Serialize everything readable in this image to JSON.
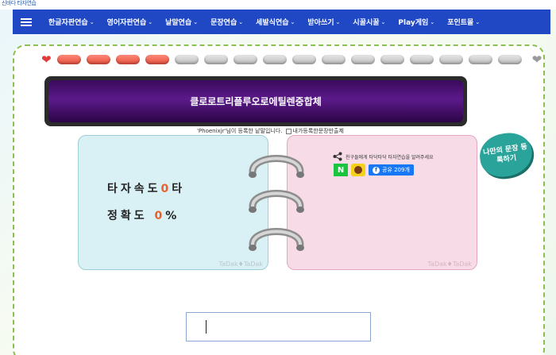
{
  "site": {
    "logo_text": "신바다 타자연습"
  },
  "nav": {
    "items": [
      {
        "label": "한글자판연습"
      },
      {
        "label": "영어자판연습"
      },
      {
        "label": "낱말연습"
      },
      {
        "label": "문장연습"
      },
      {
        "label": "세발식연습"
      },
      {
        "label": "받아쓰기"
      },
      {
        "label": "시꿀시꿀"
      },
      {
        "label": "Play게임"
      },
      {
        "label": "포인트몰"
      }
    ]
  },
  "progress": {
    "total": 16,
    "filled": 4
  },
  "word": {
    "text": "클로로트리플루오로에틸렌중합체"
  },
  "owner": {
    "text": "'Phoenixjr'님이 등록한 낱말입니다.",
    "checkbox_label": "내가등록한문장만출제"
  },
  "stats": {
    "speed_label": "타자속도",
    "speed_value": "0",
    "speed_unit": "타",
    "accuracy_label": "정확도",
    "accuracy_value": "0",
    "accuracy_unit": "%"
  },
  "watermark": "TaDak♦TaDak",
  "share": {
    "text": "친구들에게 타닥타닥 타자연습을 알려주세요",
    "naver_label": "N",
    "fb_label": "공유 209개"
  },
  "my_song": {
    "label": "나만의 문장 등록하기"
  },
  "colors": {
    "nav": "#2048c4",
    "accent": "#e8612a",
    "border": "#8cc152"
  }
}
